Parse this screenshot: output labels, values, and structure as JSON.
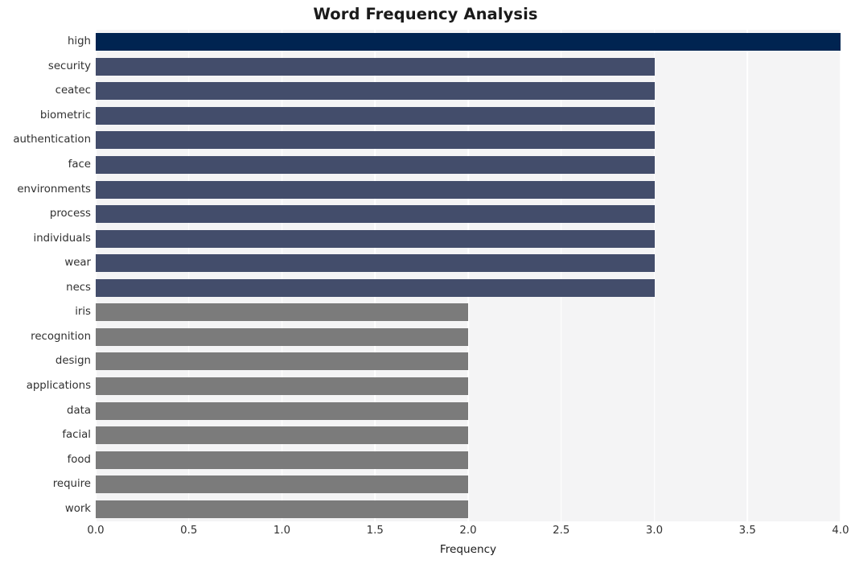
{
  "chart_data": {
    "type": "bar",
    "orientation": "horizontal",
    "title": "Word Frequency Analysis",
    "xlabel": "Frequency",
    "ylabel": "",
    "xlim": [
      0.0,
      4.0
    ],
    "grid": true,
    "legend": null,
    "xticks": [
      "0.0",
      "0.5",
      "1.0",
      "1.5",
      "2.0",
      "2.5",
      "3.0",
      "3.5",
      "4.0"
    ],
    "xtick_values": [
      0.0,
      0.5,
      1.0,
      1.5,
      2.0,
      2.5,
      3.0,
      3.5,
      4.0
    ],
    "categories": [
      "high",
      "security",
      "ceatec",
      "biometric",
      "authentication",
      "face",
      "environments",
      "process",
      "individuals",
      "wear",
      "necs",
      "iris",
      "recognition",
      "design",
      "applications",
      "data",
      "facial",
      "food",
      "require",
      "work"
    ],
    "values": [
      4,
      3,
      3,
      3,
      3,
      3,
      3,
      3,
      3,
      3,
      3,
      2,
      2,
      2,
      2,
      2,
      2,
      2,
      2,
      2
    ],
    "bar_colors": [
      "#002451",
      "#434d6b",
      "#434d6b",
      "#434d6b",
      "#434d6b",
      "#434d6b",
      "#434d6b",
      "#434d6b",
      "#434d6b",
      "#434d6b",
      "#434d6b",
      "#7b7b7b",
      "#7b7b7b",
      "#7b7b7b",
      "#7b7b7b",
      "#7b7b7b",
      "#7b7b7b",
      "#7b7b7b",
      "#7b7b7b",
      "#7b7b7b"
    ]
  },
  "style": {
    "plot_background": "#f4f4f5",
    "gridline_color": "#ffffff",
    "figure_background": "#ffffff",
    "text_color": "#313131",
    "title_color": "#1a1a1a"
  }
}
